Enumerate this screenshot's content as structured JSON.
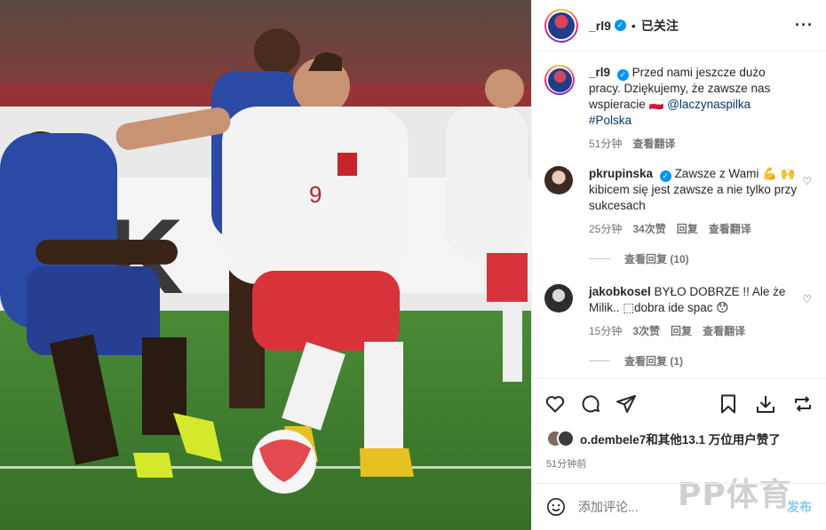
{
  "post": {
    "username": "_rl9",
    "follow_status": "已关注",
    "caption_author": "_rl9",
    "caption_text": "Przed nami jeszcze dużo pracy. Dziękujemy, że zawsze nas wspieracie 🇵🇱",
    "caption_mention": "@laczynaspilka",
    "caption_hashtag": "#Polska",
    "caption_time": "51分钟",
    "caption_translate": "查看翻译"
  },
  "comments": [
    {
      "user": "pkrupinska",
      "text": "Zawsze z Wami 💪 🙌 kibicem się jest zawsze a nie tylko przy sukcesach",
      "time": "25分钟",
      "likes": "34次赞",
      "reply": "回复",
      "translate": "查看翻译",
      "view_replies": "查看回复 (10)"
    },
    {
      "user": "jakobkosel",
      "text": "BYŁO DOBRZE !! Ale że Milik.. ⬚dobra ide spac 😯",
      "time": "15分钟",
      "likes": "3次赞",
      "reply": "回复",
      "translate": "查看翻译",
      "view_replies": "查看回复 (1)"
    }
  ],
  "likes_text": "o.dembele7和其他13.1 万位用户赞了",
  "post_time": "51分钟前",
  "comment_input": {
    "placeholder": "添加评论..."
  },
  "post_button": "发布",
  "watermark": "PP体育",
  "colors": {
    "accent": "#0095f6",
    "link": "#00376b"
  },
  "icons": [
    "more-icon",
    "verified-icon",
    "heart-icon",
    "comment-icon",
    "share-icon",
    "bookmark-icon",
    "download-icon",
    "repost-icon",
    "emoji-icon"
  ]
}
